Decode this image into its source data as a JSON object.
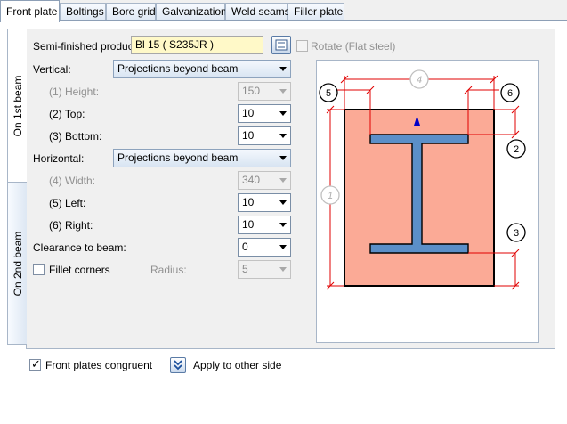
{
  "tabs": [
    {
      "label": "Front plate",
      "active": true
    },
    {
      "label": "Boltings"
    },
    {
      "label": "Bore grid"
    },
    {
      "label": "Galvanization"
    },
    {
      "label": "Weld seams"
    },
    {
      "label": "Filler plate"
    }
  ],
  "side_tabs": [
    "On 1st beam",
    "On 2nd beam"
  ],
  "form": {
    "semi_finished_label": "Semi-finished product:",
    "semi_finished_value": "Bl 15  ( S235JR )",
    "rotate_label": "Rotate (Flat steel)",
    "vertical_label": "Vertical:",
    "vertical_value": "Projections beyond beam",
    "height_label": "(1) Height:",
    "height_value": "150",
    "top_label": "(2) Top:",
    "top_value": "10",
    "bottom_label": "(3) Bottom:",
    "bottom_value": "10",
    "horizontal_label": "Horizontal:",
    "horizontal_value": "Projections beyond beam",
    "width_label": "(4) Width:",
    "width_value": "340",
    "left_label": "(5) Left:",
    "left_value": "10",
    "right_label": "(6) Right:",
    "right_value": "10",
    "clearance_label": "Clearance to beam:",
    "clearance_value": "0",
    "fillet_label": "Fillet corners",
    "radius_label": "Radius:",
    "radius_value": "5"
  },
  "diagram": {
    "markers": [
      "1",
      "2",
      "3",
      "4",
      "5",
      "6"
    ]
  },
  "bottom": {
    "congruent_label": "Front plates congruent",
    "apply_label": "Apply to other side"
  },
  "colors": {
    "plate": "#fbaa96",
    "beam": "#5b8fc8",
    "dimension": "#e00000",
    "axis": "#0000c8"
  }
}
